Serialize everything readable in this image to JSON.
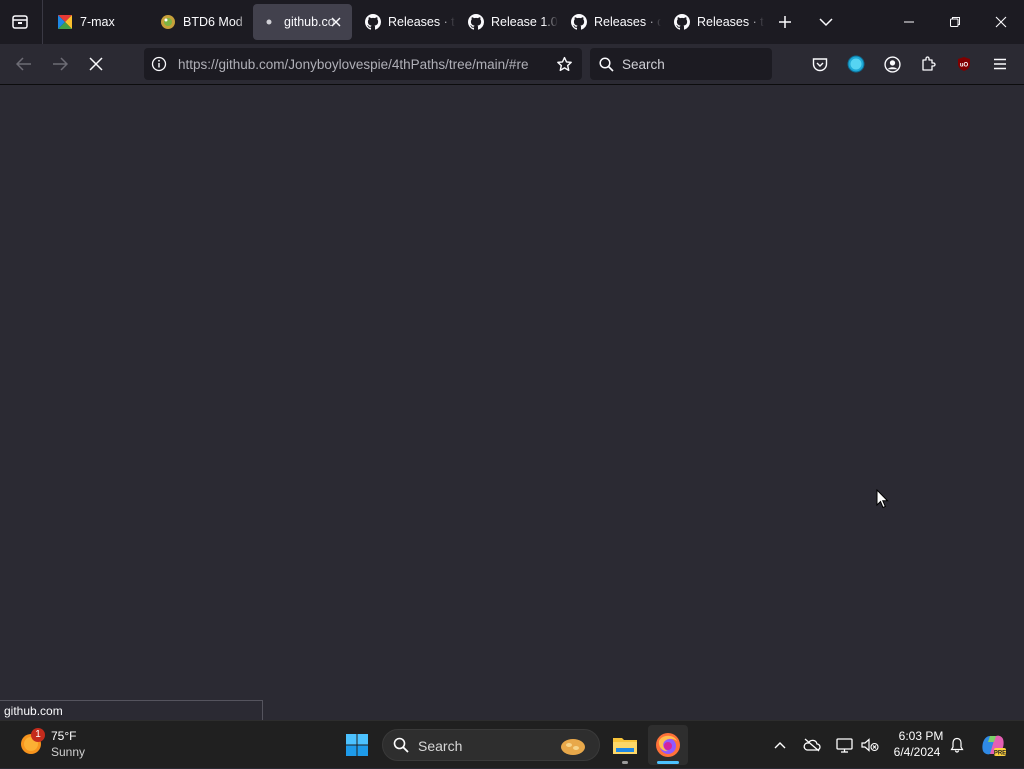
{
  "browser": {
    "tabs": [
      {
        "label": "7-max",
        "icon": "seven-max-icon",
        "active": false
      },
      {
        "label": "BTD6 Mod",
        "icon": "btd6-icon",
        "active": false
      },
      {
        "label": "github.co",
        "icon": "loading-dot-icon",
        "active": true
      },
      {
        "label": "Releases · t",
        "icon": "github-icon",
        "active": false
      },
      {
        "label": "Release 1.0",
        "icon": "github-icon",
        "active": false
      },
      {
        "label": "Releases · d",
        "icon": "github-icon",
        "active": false
      },
      {
        "label": "Releases · t",
        "icon": "github-icon",
        "active": false
      }
    ],
    "url": "https://github.com/Jonyboylovespie/4thPaths/tree/main/#re",
    "search_placeholder": "Search",
    "status_text": "github.com"
  },
  "taskbar": {
    "weather": {
      "temp": "75°F",
      "condition": "Sunny",
      "badge": "1"
    },
    "search_placeholder": "Search",
    "clock": {
      "time": "6:03 PM",
      "date": "6/4/2024"
    }
  },
  "colors": {
    "page_bg": "#2b2a33",
    "tabbar_bg": "#1c1b22",
    "active_tab_bg": "#42414d",
    "taskbar_bg": "#202020",
    "accent_blue": "#0078d4"
  }
}
